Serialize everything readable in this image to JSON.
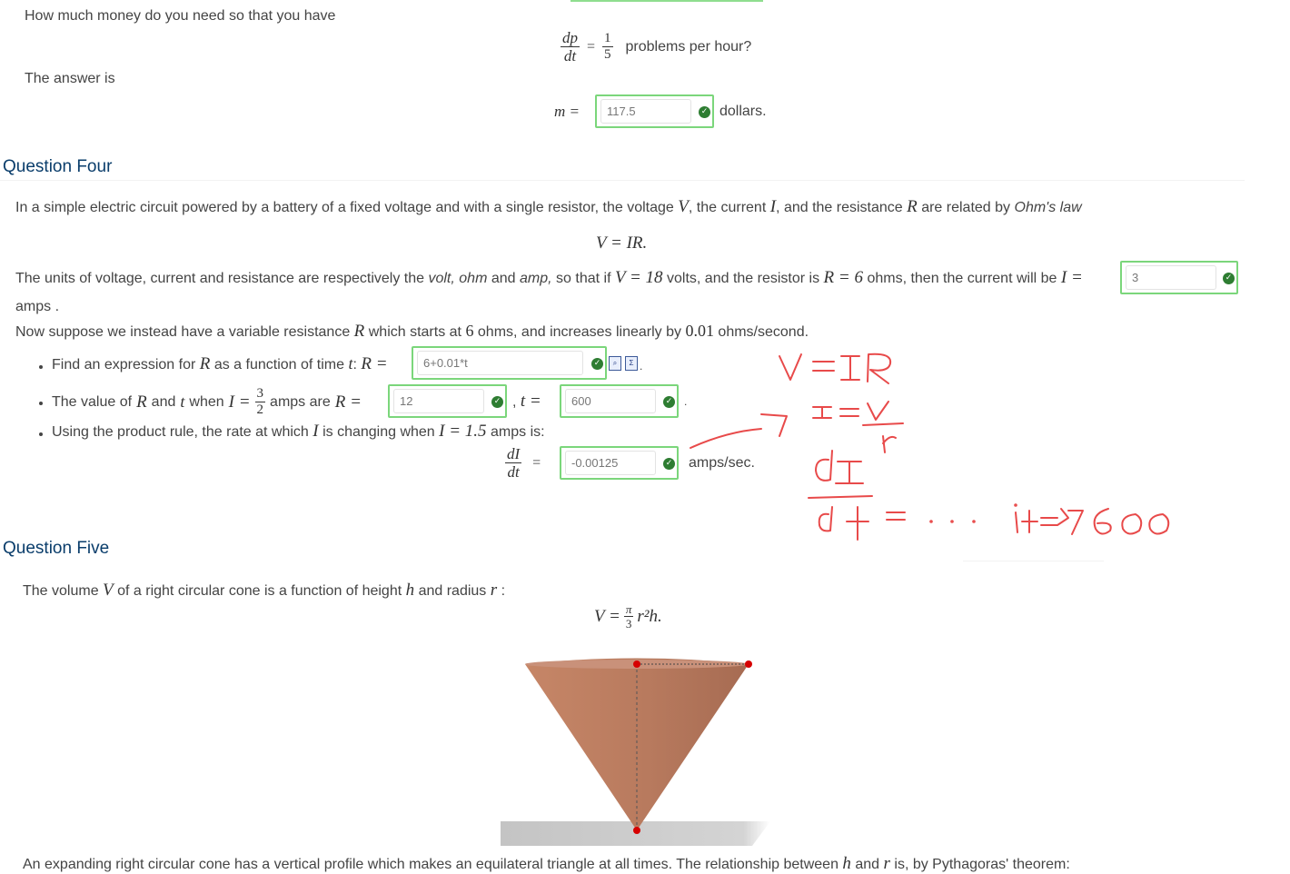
{
  "q3": {
    "question_text": "How much money do you need so that you have",
    "rate_num": "dp",
    "rate_den": "dt",
    "rate_eq": "=",
    "rate_value_num": "1",
    "rate_value_den": "5",
    "rate_suffix": "problems per hour?",
    "answer_intro": "The answer is",
    "m_label": "m =",
    "m_value": "117.5",
    "m_suffix": "dollars."
  },
  "q4": {
    "heading": "Question Four",
    "intro_prefix": "In a simple electric circuit powered by a battery of a fixed voltage and with a single resistor, the voltage",
    "var_V": "V",
    "intro_mid1": ", the current",
    "var_I": "I",
    "intro_mid2": ", and the resistance",
    "var_R": "R",
    "intro_mid3": "are related by",
    "ohms_law": "Ohm's law",
    "equation": "V = IR",
    "units_prefix": "The units of voltage, current and resistance are respectively the",
    "unit_volt": "volt,",
    "unit_ohm": "ohm",
    "units_and": "and",
    "unit_amp": "amp,",
    "units_so": "so that if",
    "cond_V": "V = 18",
    "units_volts_text": "volts, and the resistor is",
    "cond_R": "R = 6",
    "units_ohms_text": "ohms, then the current will be",
    "I_eq": "I =",
    "I_value": "3",
    "amps_text": "amps .",
    "variable_prefix": "Now suppose we instead have a variable resistance",
    "variable_mid": "which starts at",
    "start_value": "6",
    "variable_mid2": "ohms, and increases linearly by",
    "rate_value": "0.01",
    "variable_suffix": "ohms/second.",
    "bullet1_prefix": "Find an expression for",
    "bullet1_mid": "as a function of time",
    "bullet1_t": "t",
    "bullet1_eq": "R =",
    "bullet1_value": "6+0.01*t",
    "bullet2_prefix": "The value of",
    "bullet2_and": "and",
    "bullet2_when": "when",
    "bullet2_Ieq": "I =",
    "bullet2_frac_num": "3",
    "bullet2_frac_den": "2",
    "bullet2_amps_are": "amps are",
    "bullet2_Req": "R =",
    "bullet2_R_value": "12",
    "bullet2_comma": ",",
    "bullet2_teq": "t =",
    "bullet2_t_value": "600",
    "bullet2_end": ".",
    "bullet3_prefix": "Using the product rule, the rate at which",
    "bullet3_mid": "is changing when",
    "bullet3_Ieq": "I = 1.5",
    "bullet3_suffix": "amps is:",
    "dIdt_num": "dI",
    "dIdt_den": "dt",
    "dIdt_eq": "=",
    "dIdt_value": "-0.00125",
    "dIdt_suffix": "amps/sec."
  },
  "q5": {
    "heading": "Question Five",
    "intro_prefix": "The volume",
    "var_V": "V",
    "intro_mid": "of a right circular cone is a function of height",
    "var_h": "h",
    "intro_mid2": "and radius",
    "var_r": "r",
    "intro_end": ":",
    "volume_lhs": "V =",
    "volume_pi": "π",
    "volume_den": "3",
    "volume_rest": "r²h.",
    "bottom_text_prefix": "An expanding right circular cone has a vertical profile which makes an equilateral triangle at all times. The relationship between",
    "bottom_var_h": "h",
    "bottom_and": "and",
    "bottom_var_r": "r",
    "bottom_text_suffix": "is, by Pythagoras' theorem:"
  },
  "colors": {
    "heading": "#0a3d6b",
    "answer_border": "#7bd67b",
    "check": "#2e7d32",
    "ink": "#e84a4a",
    "cone": "#c8866a"
  },
  "icons": [
    "check-icon",
    "preview-icon",
    "equation-editor-icon"
  ]
}
